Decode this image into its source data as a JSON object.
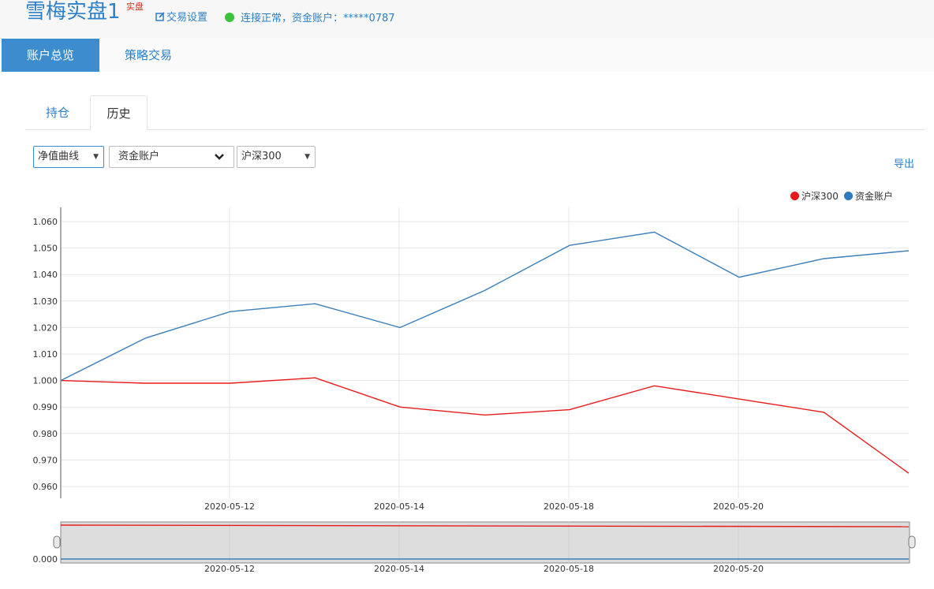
{
  "header": {
    "title": "雪梅实盘1",
    "badge": "实盘",
    "settings_label": "交易设置",
    "status_text": "连接正常，资金账户：*****0787"
  },
  "nav": {
    "tabs": [
      {
        "label": "账户总览",
        "active": true
      },
      {
        "label": "策略交易",
        "active": false
      }
    ]
  },
  "subtabs": [
    {
      "label": "持仓",
      "active": false
    },
    {
      "label": "历史",
      "active": true
    }
  ],
  "filters": {
    "chart_type": "净值曲线",
    "account": "资金账户",
    "benchmark": "沪深300"
  },
  "export_label": "导出",
  "colors": {
    "accent": "#3d8ccd",
    "series_account": "#3b7fb8",
    "series_benchmark": "#e81b1b",
    "status_ok": "#3cc23c",
    "badge": "#e8251d"
  },
  "chart_data": {
    "type": "line",
    "ylim": [
      0.955,
      1.066
    ],
    "yticks": [
      "1.060",
      "1.050",
      "1.040",
      "1.030",
      "1.020",
      "1.010",
      "1.000",
      "0.990",
      "0.980",
      "0.970",
      "0.960"
    ],
    "xtick_labels": [
      "2020-05-12",
      "2020-05-14",
      "2020-05-18",
      "2020-05-20"
    ],
    "legend_position": "top-right",
    "grid": true,
    "series": [
      {
        "name": "沪深300",
        "values": [
          1.0,
          0.999,
          0.999,
          1.001,
          0.99,
          0.987,
          0.989,
          0.998,
          0.993,
          0.988,
          0.965
        ]
      },
      {
        "name": "资金账户",
        "values": [
          1.0,
          1.016,
          1.026,
          1.029,
          1.02,
          1.034,
          1.051,
          1.056,
          1.039,
          1.046,
          1.049
        ]
      }
    ],
    "navigator": {
      "ytick": "0.000",
      "xtick_labels": [
        "2020-05-12",
        "2020-05-14",
        "2020-05-18",
        "2020-05-20"
      ]
    }
  }
}
